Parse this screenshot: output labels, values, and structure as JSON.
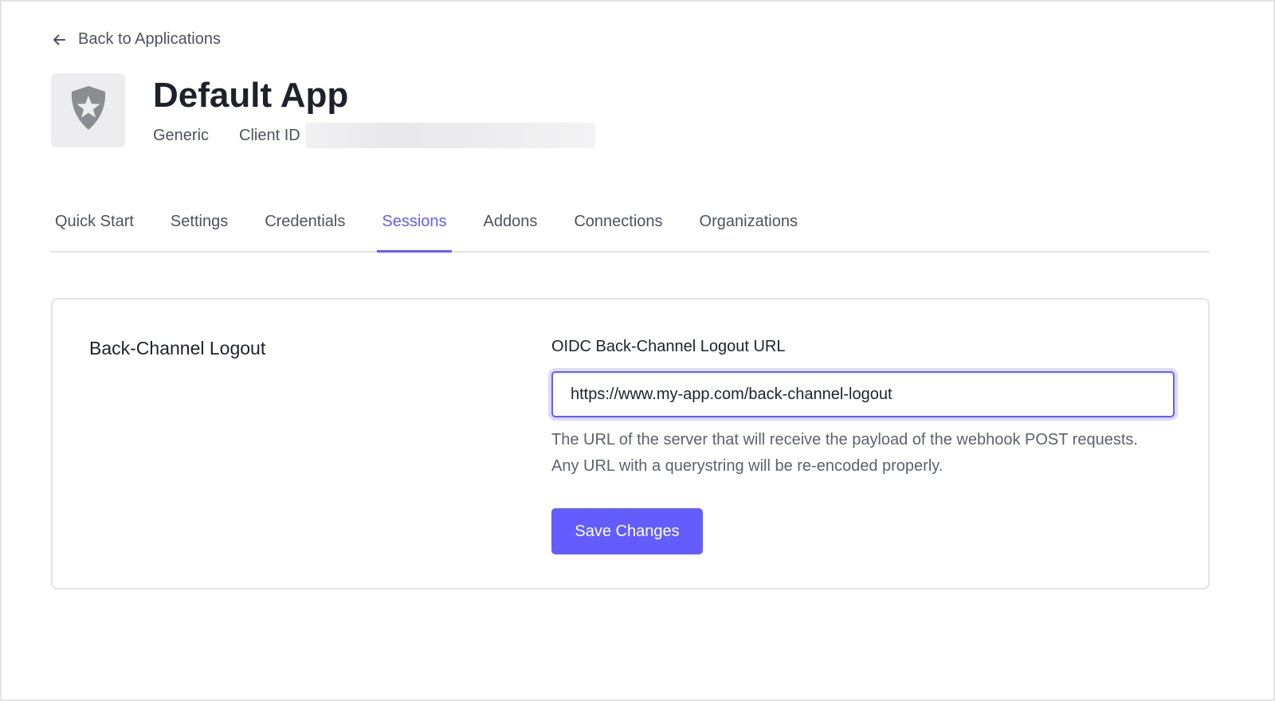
{
  "nav": {
    "back_label": "Back to Applications",
    "back_icon": "arrow-left-icon"
  },
  "app": {
    "name": "Default App",
    "type": "Generic",
    "client_id_label": "Client ID",
    "client_id_value": "",
    "logo_icon": "shield-star-icon"
  },
  "tabs": [
    {
      "label": "Quick Start",
      "active": false
    },
    {
      "label": "Settings",
      "active": false
    },
    {
      "label": "Credentials",
      "active": false
    },
    {
      "label": "Sessions",
      "active": true
    },
    {
      "label": "Addons",
      "active": false
    },
    {
      "label": "Connections",
      "active": false
    },
    {
      "label": "Organizations",
      "active": false
    }
  ],
  "sessions": {
    "section_title": "Back-Channel Logout",
    "field_label": "OIDC Back-Channel Logout URL",
    "field_value": "https://www.my-app.com/back-channel-logout",
    "help_text": "The URL of the server that will receive the payload of the webhook POST requests. Any URL with a querystring will be re-encoded properly.",
    "save_label": "Save Changes"
  },
  "colors": {
    "accent": "#635dff",
    "text_primary": "#1e212a",
    "text_secondary": "#4f525b",
    "border": "#e3e3e6"
  }
}
